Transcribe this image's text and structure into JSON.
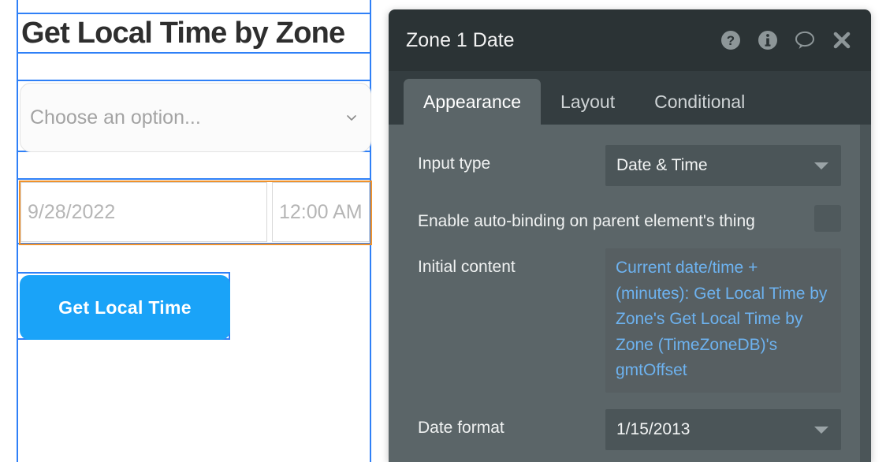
{
  "canvas": {
    "page_title": "Get Local Time by Zone",
    "dropdown": {
      "placeholder": "Choose an option...",
      "chevron_icon": "chevron-down-icon"
    },
    "date_input": {
      "placeholder": "9/28/2022"
    },
    "time_input": {
      "placeholder": "12:00 AM"
    },
    "button": {
      "label": "Get Local Time"
    },
    "colors": {
      "selection_blue": "#2f80f7",
      "selection_orange": "#f0922b",
      "button_blue": "#1aa3f8"
    }
  },
  "panel": {
    "title": "Zone 1 Date",
    "header_icons": [
      {
        "name": "help-icon",
        "glyph": "question-circle"
      },
      {
        "name": "info-icon",
        "glyph": "info-circle"
      },
      {
        "name": "comment-icon",
        "glyph": "speech-bubble"
      },
      {
        "name": "close-icon",
        "glyph": "x"
      }
    ],
    "tabs": [
      {
        "label": "Appearance",
        "active": true
      },
      {
        "label": "Layout",
        "active": false
      },
      {
        "label": "Conditional",
        "active": false
      }
    ],
    "properties": {
      "input_type": {
        "label": "Input type",
        "value": "Date & Time"
      },
      "auto_binding": {
        "label": "Enable auto-binding on parent element's thing",
        "checked": false
      },
      "initial_content": {
        "label": "Initial content",
        "value": "Current date/time + (minutes): Get Local Time by Zone's Get Local Time by Zone (TimeZoneDB)'s gmtOffset"
      },
      "date_format": {
        "label": "Date format",
        "value": "1/15/2013"
      }
    },
    "colors": {
      "header_bg": "#2b3335",
      "tabbar_bg": "#343d40",
      "body_bg": "#5b6568",
      "field_bg": "#4b5558",
      "expression_blue": "#6db2ef"
    }
  }
}
